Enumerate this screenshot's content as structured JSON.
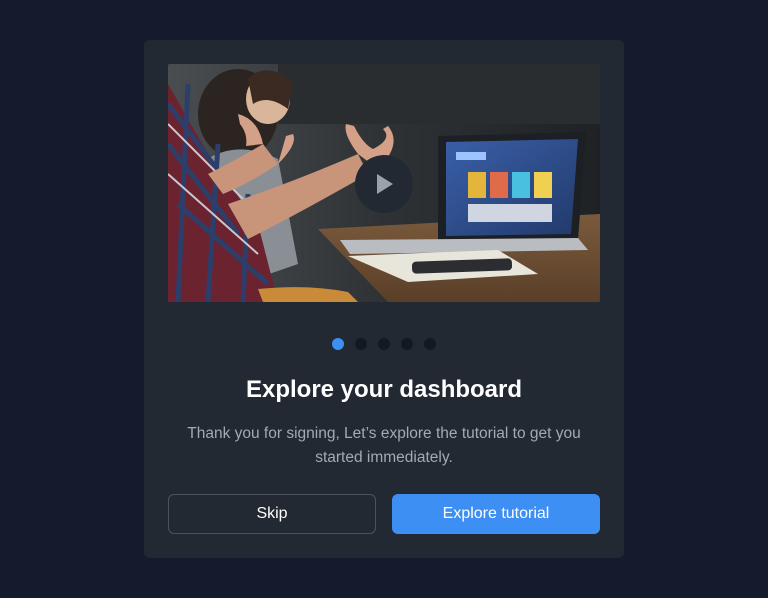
{
  "modal": {
    "media": {
      "image": "team-meeting-laptop-photo",
      "play_icon": "play-icon"
    },
    "pagination": {
      "total": 5,
      "active_index": 0
    },
    "title": "Explore your dashboard",
    "description": "Thank you for signing, Let’s explore the tutorial to get you started immediately.",
    "buttons": {
      "skip_label": "Skip",
      "explore_label": "Explore tutorial"
    }
  },
  "colors": {
    "page_background": "#141b2d",
    "modal_background": "#222932",
    "accent": "#3e8ff3",
    "dot_inactive": "#131922",
    "muted_text": "#a3aab3"
  }
}
